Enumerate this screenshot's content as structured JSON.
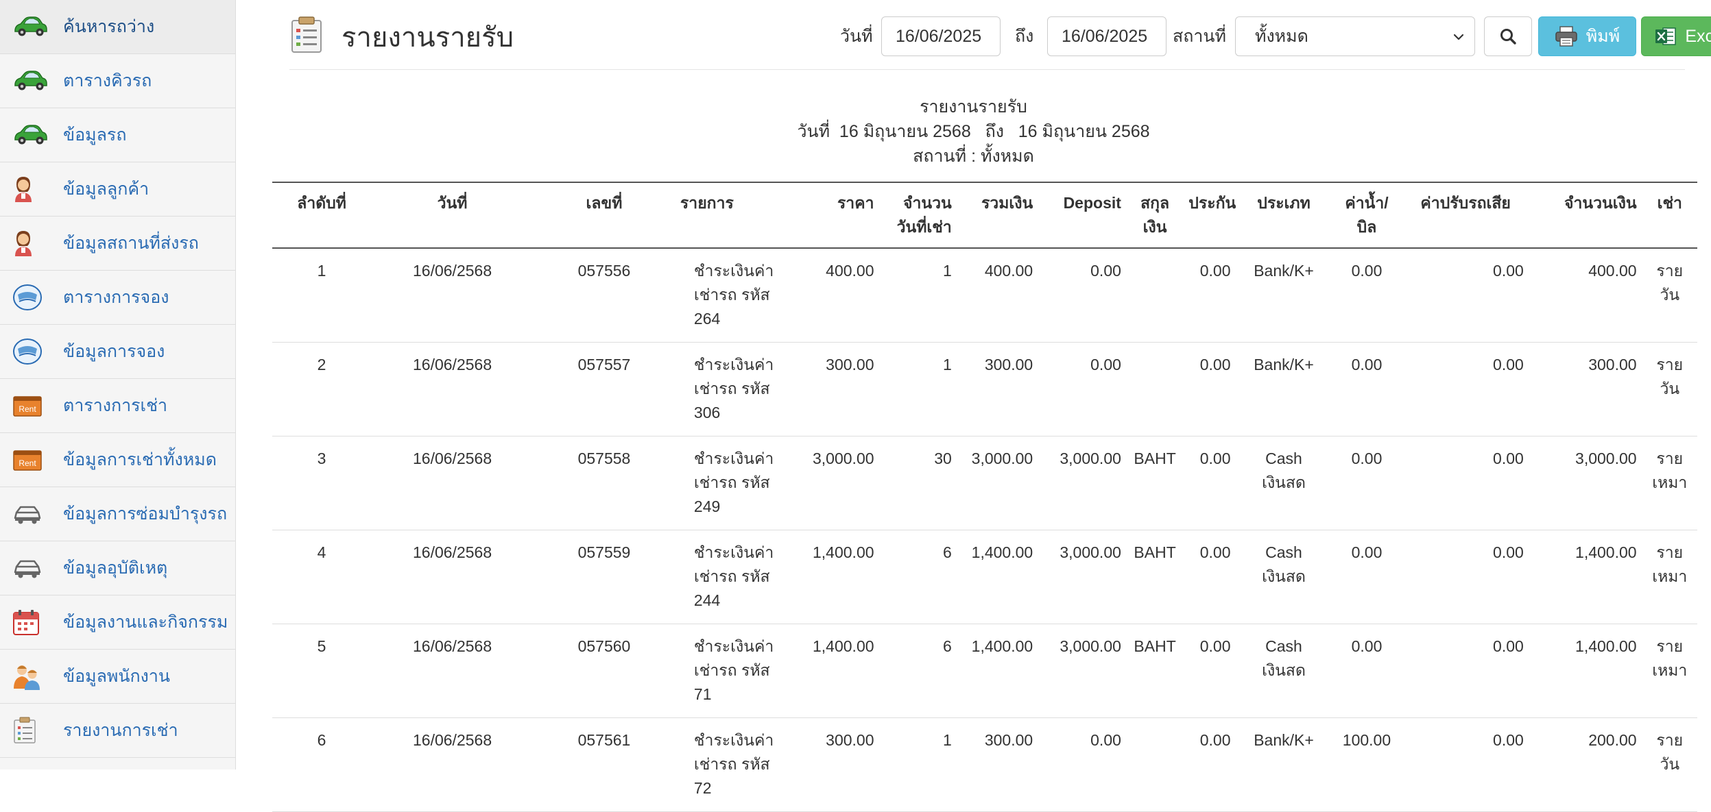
{
  "sidebar": {
    "items": [
      {
        "label": "ค้นหารถว่าง",
        "icon": "car-icon"
      },
      {
        "label": "ตารางคิวรถ",
        "icon": "car-icon"
      },
      {
        "label": "ข้อมูลรถ",
        "icon": "car-icon"
      },
      {
        "label": "ข้อมูลลูกค้า",
        "icon": "customer-icon"
      },
      {
        "label": "ข้อมูลสถานที่ส่งรถ",
        "icon": "customer-icon"
      },
      {
        "label": "ตารางการจอง",
        "icon": "booking-icon"
      },
      {
        "label": "ข้อมูลการจอง",
        "icon": "booking-icon"
      },
      {
        "label": "ตารางการเช่า",
        "icon": "rent-icon",
        "badge": "Rent"
      },
      {
        "label": "ข้อมูลการเช่าทั้งหมด",
        "icon": "rent-icon",
        "badge": "Rent"
      },
      {
        "label": "ข้อมูลการซ่อมบำรุงรถ",
        "icon": "car-outline-icon"
      },
      {
        "label": "ข้อมูลอุบัติเหตุ",
        "icon": "car-outline-icon"
      },
      {
        "label": "ข้อมูลงานและกิจกรรม",
        "icon": "calendar-icon"
      },
      {
        "label": "ข้อมูลพนักงาน",
        "icon": "employees-icon"
      },
      {
        "label": "รายงานการเช่า",
        "icon": "report-icon"
      }
    ]
  },
  "header": {
    "title": "รายงานรายรับ",
    "date_from_label": "วันที่",
    "date_from": "16/06/2025",
    "date_to_label": "ถึง",
    "date_to": "16/06/2025",
    "location_label": "สถานที่",
    "location_selected": "ทั้งหมด",
    "print_label": "พิมพ์",
    "excel_label": "Excel"
  },
  "report": {
    "title": "รายงานรายรับ",
    "date_line": "วันที่  16 มิถุนายน 2568   ถึง   16 มิถุนายน 2568",
    "location_line": "สถานที่ : ทั้งหมด",
    "columns": [
      "ลำดับที่",
      "วันที่",
      "เลขที่",
      "รายการ",
      "ราคา",
      "จำนวน วันที่เช่า",
      "รวมเงิน",
      "Deposit",
      "สกุล เงิน",
      "ประกัน",
      "ประเภท",
      "ค่าน้ำ/ บิล",
      "ค่าปรับรถเสีย",
      "จำนวนเงิน",
      "เช่า"
    ],
    "rows": [
      [
        "1",
        "16/06/2568",
        "057556",
        "ชำระเงินค่าเช่ารถ รหัส 264",
        "400.00",
        "1",
        "400.00",
        "0.00",
        "",
        "0.00",
        "Bank/K+",
        "0.00",
        "0.00",
        "400.00",
        "รายวัน"
      ],
      [
        "2",
        "16/06/2568",
        "057557",
        "ชำระเงินค่าเช่ารถ รหัส 306",
        "300.00",
        "1",
        "300.00",
        "0.00",
        "",
        "0.00",
        "Bank/K+",
        "0.00",
        "0.00",
        "300.00",
        "รายวัน"
      ],
      [
        "3",
        "16/06/2568",
        "057558",
        "ชำระเงินค่าเช่ารถ รหัส 249",
        "3,000.00",
        "30",
        "3,000.00",
        "3,000.00",
        "BAHT",
        "0.00",
        "Cash เงินสด",
        "0.00",
        "0.00",
        "3,000.00",
        "รายเหมา"
      ],
      [
        "4",
        "16/06/2568",
        "057559",
        "ชำระเงินค่าเช่ารถ รหัส 244",
        "1,400.00",
        "6",
        "1,400.00",
        "3,000.00",
        "BAHT",
        "0.00",
        "Cash เงินสด",
        "0.00",
        "0.00",
        "1,400.00",
        "รายเหมา"
      ],
      [
        "5",
        "16/06/2568",
        "057560",
        "ชำระเงินค่าเช่ารถ รหัส 71",
        "1,400.00",
        "6",
        "1,400.00",
        "3,000.00",
        "BAHT",
        "0.00",
        "Cash เงินสด",
        "0.00",
        "0.00",
        "1,400.00",
        "รายเหมา"
      ],
      [
        "6",
        "16/06/2568",
        "057561",
        "ชำระเงินค่าเช่ารถ รหัส 72",
        "300.00",
        "1",
        "300.00",
        "0.00",
        "",
        "0.00",
        "Bank/K+",
        "100.00",
        "0.00",
        "200.00",
        "รายวัน"
      ]
    ]
  },
  "colors": {
    "link": "#2a6bb3",
    "print_button": "#5bc0de",
    "excel_button": "#5cb85c"
  }
}
